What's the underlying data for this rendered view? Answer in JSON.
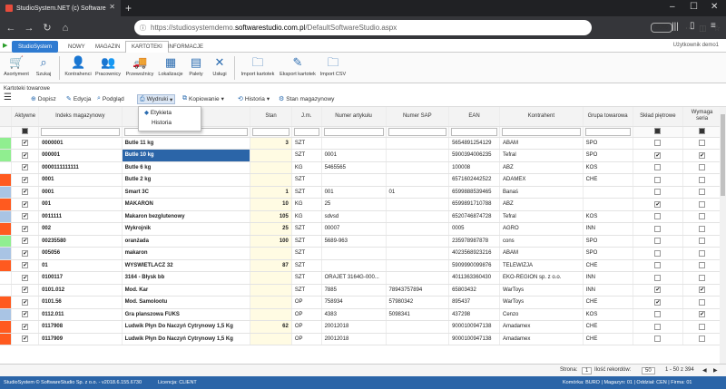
{
  "browser": {
    "tab_title": "StudioSystem.NET (c) Software",
    "url_prefix": "https://studiosystemdemo.",
    "url_domain": "softwarestudio.com.pl",
    "url_path": "/DefaultSoftwareStudio.aspx",
    "zoom": "80%"
  },
  "app_tabs": {
    "studio": "StudioSystem",
    "t1": "NOWY",
    "t2": "MAGAZIN",
    "t3": "KARTOTEKI",
    "t4": "INFORMACJE"
  },
  "user": "Użytkownik demo1",
  "ribbon": [
    "Asortyment",
    "Szukaj",
    "Kontrahenci",
    "Pracownicy",
    "Przewoźnicy",
    "Lokalizacje",
    "Palety",
    "Usługi",
    "Import kartotek",
    "Eksport kartotek",
    "Import CSV"
  ],
  "subtitle": "Kartoteki towarowe",
  "toolbar": {
    "add": "Dopisz",
    "edit": "Edycja",
    "preview": "Podgląd",
    "prints": "Wydruki",
    "copy": "Kopiowanie",
    "history": "Historia",
    "stock": "Stan magazynowy"
  },
  "menu": {
    "item1": "Etykieta",
    "item2": "Historia"
  },
  "columns": {
    "active": "Aktywne",
    "index": "Indeks magazynowy",
    "name": "",
    "stan": "Stan",
    "jm": "J.m.",
    "artnum": "Numer artykułu",
    "sap": "Numer SAP",
    "ean": "EAN",
    "kontrahent": "Kontrahent",
    "grupa": "Grupa towarowa",
    "sklad": "Skład piętrowe",
    "wymaga": "Wymaga seria"
  },
  "colors": {
    "green": "#90ee90",
    "orange": "#ff5a1f",
    "blue": "#a9c4e4",
    "white": "#ffffff"
  },
  "rows": [
    {
      "c": "green",
      "idx": "0000001",
      "name": "Butle 11 kg",
      "stan": "3",
      "jm": "SZT",
      "art": "",
      "sap": "",
      "ean": "5654891254129",
      "k": "ABAM",
      "g": "SPO",
      "s": false,
      "w": false
    },
    {
      "c": "green",
      "idx": "000001",
      "name": "Butle 10 kg",
      "stan": "",
      "jm": "SZT",
      "art": "0001",
      "sap": "",
      "ean": "5900394006235",
      "k": "Tefral",
      "g": "SPO",
      "s": true,
      "w": true,
      "selected": true
    },
    {
      "c": "white",
      "idx": "0000111111111",
      "name": "Butle 6 kg",
      "stan": "",
      "jm": "KG",
      "art": "5465565",
      "sap": "",
      "ean": "100008",
      "k": "ABZ",
      "g": "KOS",
      "s": false,
      "w": false
    },
    {
      "c": "orange",
      "idx": "0001",
      "name": "Butle 2 kg",
      "stan": "",
      "jm": "SZT",
      "art": "",
      "sap": "",
      "ean": "6571602442522",
      "k": "ADAMEX",
      "g": "CHE",
      "s": false,
      "w": false
    },
    {
      "c": "blue",
      "idx": "0001",
      "name": "Smart 3C",
      "stan": "1",
      "jm": "SZT",
      "art": "001",
      "sap": "01",
      "ean": "6599888539465",
      "k": "Banaś",
      "g": "",
      "s": false,
      "w": false
    },
    {
      "c": "orange",
      "idx": "001",
      "name": "MAKARON",
      "stan": "10",
      "jm": "KG",
      "art": "25",
      "sap": "",
      "ean": "6599891710788",
      "k": "ABZ",
      "g": "",
      "s": true,
      "w": false
    },
    {
      "c": "blue",
      "idx": "0011111",
      "name": "Makaron bezglutenowy",
      "stan": "105",
      "jm": "KG",
      "art": "sdvsd",
      "sap": "",
      "ean": "6520746874728",
      "k": "Tefral",
      "g": "KOS",
      "s": false,
      "w": false
    },
    {
      "c": "orange",
      "idx": "002",
      "name": "Wykrojnik",
      "stan": "25",
      "jm": "SZT",
      "art": "00007",
      "sap": "",
      "ean": "0005",
      "k": "AGRO",
      "g": "INN",
      "s": false,
      "w": false
    },
    {
      "c": "green",
      "idx": "00235580",
      "name": "oranżada",
      "stan": "100",
      "jm": "SZT",
      "art": "5689-963",
      "sap": "",
      "ean": "23597898787​8",
      "k": "cons",
      "g": "SPO",
      "s": false,
      "w": false
    },
    {
      "c": "blue",
      "idx": "005056",
      "name": "makaron",
      "stan": "",
      "jm": "SZT",
      "art": "",
      "sap": "",
      "ean": "4023568923216",
      "k": "ABAM",
      "g": "SPO",
      "s": false,
      "w": false
    },
    {
      "c": "orange",
      "idx": "01",
      "name": "WYSWIETLACZ 32",
      "stan": "87",
      "jm": "SZT",
      "art": "",
      "sap": "",
      "ean": "5909990099876",
      "k": "TELEWIZJA",
      "g": "CHE",
      "s": false,
      "w": false
    },
    {
      "c": "white",
      "idx": "0100117",
      "name": "3164 - Błysk bb",
      "stan": "",
      "jm": "SZT",
      "art": "ORAJET 3164G-000...",
      "sap": "",
      "ean": "4011363360430",
      "k": "EKO-REGION sp. z o.o.",
      "g": "INN",
      "s": false,
      "w": false
    },
    {
      "c": "white",
      "idx": "0101.012",
      "name": "Mod. Kar",
      "stan": "",
      "jm": "SZT",
      "art": "7885",
      "sap": "78943757894",
      "ean": "65803432",
      "k": "WarToys",
      "g": "INN",
      "s": true,
      "w": true
    },
    {
      "c": "orange",
      "idx": "0101.56",
      "name": "Mod. Samolootu",
      "stan": "",
      "jm": "OP",
      "art": "758934",
      "sap": "57980342",
      "ean": "895437",
      "k": "WarToys",
      "g": "CHE",
      "s": true,
      "w": false
    },
    {
      "c": "blue",
      "idx": "0112.011",
      "name": "Gra planszowa FUKS",
      "stan": "",
      "jm": "OP",
      "art": "4383",
      "sap": "5098341",
      "ean": "437298",
      "k": "Cenzo",
      "g": "KOS",
      "s": false,
      "w": true
    },
    {
      "c": "orange",
      "idx": "0117908",
      "name": "Ludwik Płyn Do Naczyń Cytrynowy 1,5 Kg",
      "stan": "62",
      "jm": "OP",
      "art": "20012018",
      "sap": "",
      "ean": "9000100947138",
      "k": "Amadamex",
      "g": "CHE",
      "s": false,
      "w": false
    },
    {
      "c": "orange",
      "idx": "0117909",
      "name": "Ludwik Płyn Do Naczyń Cytrynowy 1,5 Kg",
      "stan": "",
      "jm": "OP",
      "art": "20012018",
      "sap": "",
      "ean": "9000100947138",
      "k": "Amadamex",
      "g": "CHE",
      "s": false,
      "w": false
    }
  ],
  "pager": {
    "page_label": "Strona:",
    "page": "1",
    "count_label": "Ilość rekordów:",
    "count": "50",
    "range": "1 - 50 z 394"
  },
  "status": {
    "left": "StudioSystem © SoftwareStudio Sp. z o.o. - v2018.6.155.6730",
    "license": "Licencja: CLIENT",
    "right": "Komórka: BURO | Magazyn: 01 | Oddział: CEN | Firma: 01"
  }
}
